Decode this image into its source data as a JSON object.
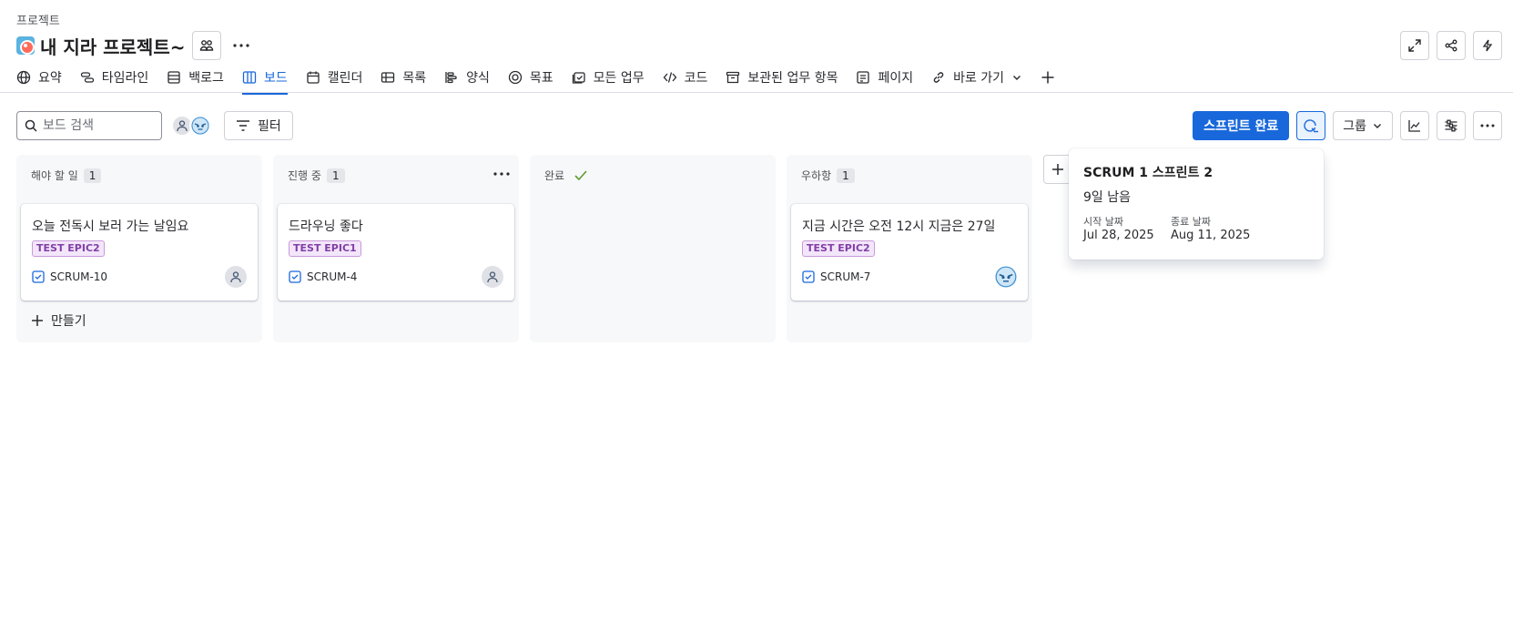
{
  "breadcrumb": "프로젝트",
  "project": {
    "title": "내 지라 프로젝트~"
  },
  "tabs": [
    {
      "label": "요약",
      "icon": "globe-icon"
    },
    {
      "label": "타임라인",
      "icon": "timeline-icon"
    },
    {
      "label": "백로그",
      "icon": "backlog-icon"
    },
    {
      "label": "보드",
      "icon": "board-icon",
      "active": true
    },
    {
      "label": "캘린더",
      "icon": "calendar-icon"
    },
    {
      "label": "목록",
      "icon": "list-icon"
    },
    {
      "label": "양식",
      "icon": "form-icon"
    },
    {
      "label": "목표",
      "icon": "goal-icon"
    },
    {
      "label": "모든 업무",
      "icon": "all-work-icon"
    },
    {
      "label": "코드",
      "icon": "code-icon"
    },
    {
      "label": "보관된 업무 항목",
      "icon": "archive-icon"
    },
    {
      "label": "페이지",
      "icon": "page-icon"
    },
    {
      "label": "바로 가기",
      "icon": "link-icon"
    }
  ],
  "toolbar": {
    "search_placeholder": "보드 검색",
    "filter_label": "필터",
    "complete_sprint_label": "스프린트 완료",
    "group_label": "그룹"
  },
  "columns": [
    {
      "name": "해야 할 일",
      "count": "1",
      "card": {
        "title": "오늘 전독시 보러 가는 날임요",
        "epic": "TEST EPIC2",
        "key": "SCRUM-10",
        "assignee": "default-avatar"
      },
      "create_label": "만들기"
    },
    {
      "name": "진행 중",
      "count": "1",
      "card": {
        "title": "드라우닝 좋다",
        "epic": "TEST EPIC1",
        "key": "SCRUM-4",
        "assignee": "default-avatar"
      }
    },
    {
      "name": "완료",
      "count": ""
    },
    {
      "name": "우하항",
      "count": "1",
      "card": {
        "title": "지금 시간은 오전 12시 지금은 27일",
        "epic": "TEST EPIC2",
        "key": "SCRUM-7",
        "assignee": "bot-avatar"
      }
    }
  ],
  "sprint_popup": {
    "title": "SCRUM 1 스프린트 2",
    "remaining": "9일 남음",
    "start_label": "시작 날짜",
    "start_value": "Jul 28, 2025",
    "end_label": "종료 날짜",
    "end_value": "Aug 11, 2025"
  },
  "colors": {
    "accent": "#1868db",
    "epic_bg": "#f3e6fb",
    "epic_text": "#803fa5",
    "column_bg": "#f7f8f9"
  }
}
